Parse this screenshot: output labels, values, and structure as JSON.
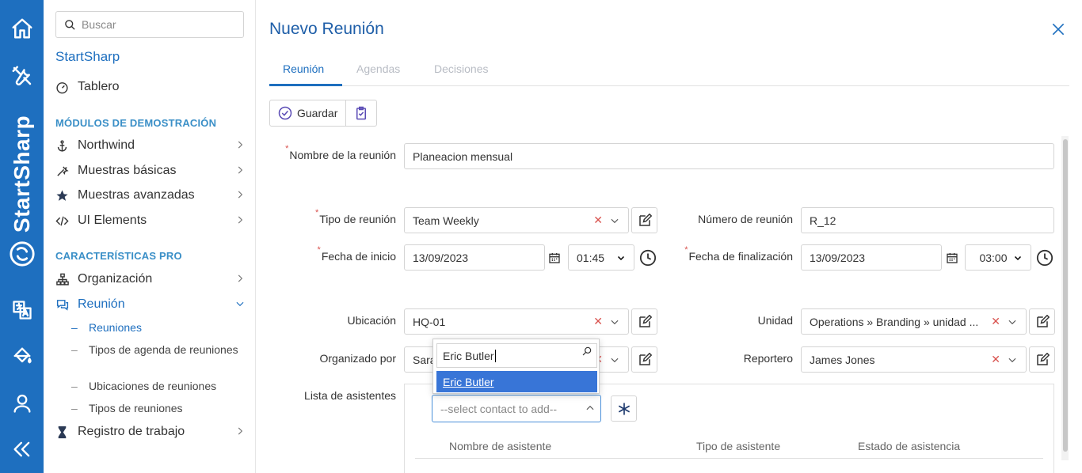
{
  "rail": {
    "brand": "StartSharp",
    "icons": [
      "home-icon",
      "tools-icon",
      "logo-icon",
      "translate-icon",
      "paint-bucket-icon",
      "user-icon",
      "collapse-icon"
    ]
  },
  "sidebar": {
    "search_placeholder": "Buscar",
    "app_title": "StartSharp",
    "dashboard": "Tablero",
    "section_demo": "MÓDULOS DE DEMOSTRACIÓN",
    "demo_items": [
      {
        "label": "Northwind",
        "icon": "anchor-icon"
      },
      {
        "label": "Muestras básicas",
        "icon": "wand-icon"
      },
      {
        "label": "Muestras avanzadas",
        "icon": "star-icon"
      },
      {
        "label": "UI Elements",
        "icon": "code-icon"
      }
    ],
    "section_pro": "CARACTERÍSTICAS PRO",
    "pro_items": [
      {
        "label": "Organización",
        "icon": "org-chart-icon"
      },
      {
        "label": "Reunión",
        "icon": "chat-icon"
      }
    ],
    "meeting_sub": [
      "Reuniones",
      "Tipos de agenda de reuniones",
      "Ubicaciones de reuniones",
      "Tipos de reuniones"
    ],
    "worklog": "Registro de trabajo"
  },
  "dialog": {
    "title": "Nuevo Reunión",
    "tabs": [
      "Reunión",
      "Agendas",
      "Decisiones"
    ],
    "save_label": "Guardar"
  },
  "form": {
    "name_label": "Nombre de la reunión",
    "name_value": "Planeacion mensual",
    "type_label": "Tipo de reunión",
    "type_value": "Team Weekly",
    "number_label": "Número de reunión",
    "number_value": "R_12",
    "start_label": "Fecha de inicio",
    "start_date": "13/09/2023",
    "start_time": "01:45",
    "end_label": "Fecha de finalización",
    "end_date": "13/09/2023",
    "end_time": "03:00",
    "location_label": "Ubicación",
    "location_value": "HQ-01",
    "unit_label": "Unidad",
    "unit_value": "Operations » Branding » unidad ...",
    "organizer_label": "Organizado por",
    "organizer_value": "Sara",
    "reporter_label": "Reportero",
    "reporter_value": "James Jones",
    "attendees_label": "Lista de asistentes",
    "contact_placeholder": "--select contact to add--",
    "popup_search": "Eric Butler",
    "popup_result": "Eric Butler",
    "columns": [
      "Nombre de asistente",
      "Tipo de asistente",
      "Estado de asistencia"
    ]
  },
  "colors": {
    "accent": "#1e6fbf",
    "rail": "#1e6fbf",
    "required": "#d9534f",
    "selected": "#3875d7"
  }
}
